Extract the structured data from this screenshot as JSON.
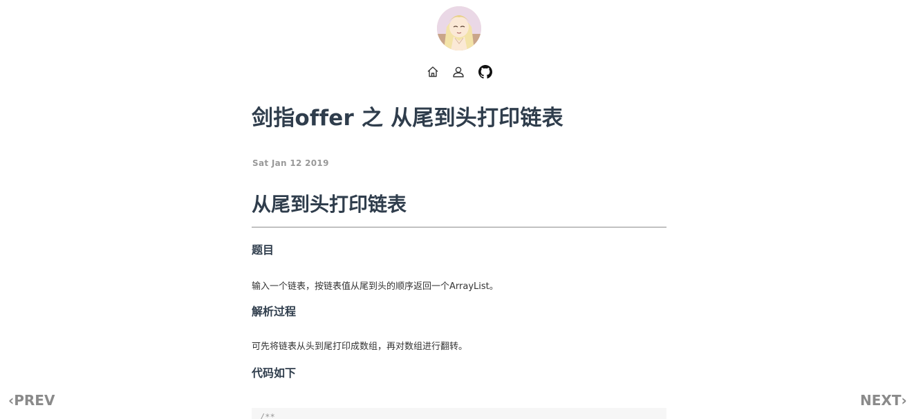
{
  "nav": {
    "icons": [
      "home-icon",
      "user-icon",
      "github-icon"
    ]
  },
  "post": {
    "title": "剑指offer 之 从尾到头打印链表",
    "date": "Sat Jan 12 2019"
  },
  "article": {
    "heading": "从尾到头打印链表",
    "sections": [
      {
        "heading": "题目",
        "text": "输入一个链表，按链表值从尾到头的顺序返回一个ArrayList。"
      },
      {
        "heading": "解析过程",
        "text": "可先将链表从头到尾打印成数组，再对数组进行翻转。"
      },
      {
        "heading": "代码如下",
        "text": ""
      }
    ],
    "code_first_line": "/**"
  },
  "pager": {
    "prev_label": "PREV",
    "next_label": "NEXT",
    "prev_chevron": "‹",
    "next_chevron": "›"
  },
  "colors": {
    "title": "#2f3d4c",
    "date": "#999999",
    "pager": "#8a8a8a"
  }
}
